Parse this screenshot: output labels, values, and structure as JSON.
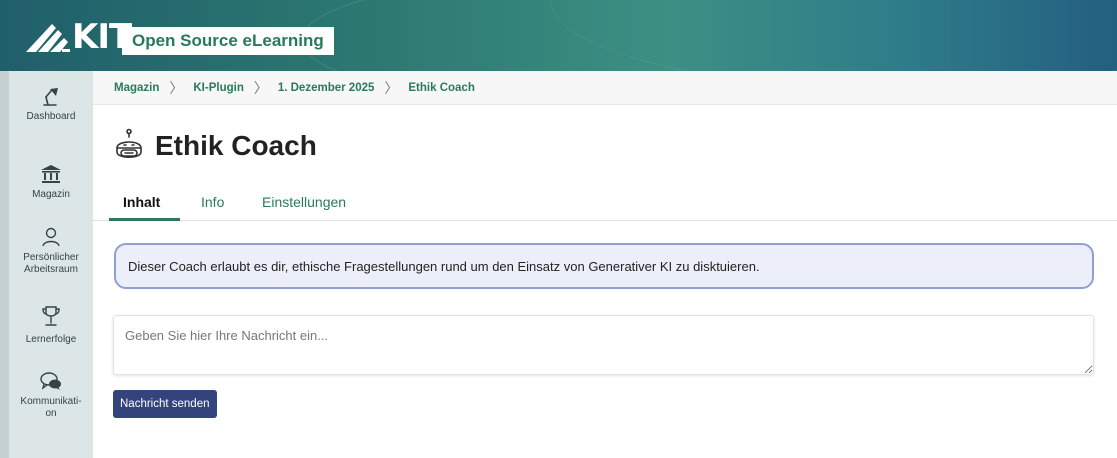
{
  "header": {
    "logo_text": "KIT",
    "brand": "Open Source eLearning",
    "colors": {
      "brand_green": "#2a7a58",
      "header_teal": "#2d7a72"
    }
  },
  "rail": {
    "items": [
      {
        "label": "Dashboard",
        "icon": "desk-lamp-icon"
      },
      {
        "label": "Magazin",
        "icon": "bank-building-icon"
      },
      {
        "label_line1": "Persönlicher",
        "label_line2": "Arbeitsraum",
        "icon": "person-icon"
      },
      {
        "label": "Lernerfolge",
        "icon": "trophy-icon"
      },
      {
        "label_line1": "Kommunikati-",
        "label_line2": "on",
        "icon": "speech-bubbles-icon"
      }
    ]
  },
  "breadcrumb": {
    "items": [
      "Magazin",
      "KI-Plugin",
      "1. Dezember 2025",
      "Ethik Coach"
    ],
    "separator": ">"
  },
  "page": {
    "title": "Ethik Coach",
    "title_icon": "robot-icon"
  },
  "tabs": [
    {
      "label": "Inhalt",
      "active": true
    },
    {
      "label": "Info",
      "active": false
    },
    {
      "label": "Einstellungen",
      "active": false
    }
  ],
  "coach": {
    "intro": "Dieser Coach erlaubt es dir, ethische Fragestellungen rund um den Einsatz von Generativer KI zu disktuieren.",
    "input_value": "",
    "input_placeholder": "Geben Sie hier Ihre Nachricht ein...",
    "send_label": "Nachricht senden",
    "button_color": "#33437b",
    "infobox_border": "#8e9fd4"
  }
}
